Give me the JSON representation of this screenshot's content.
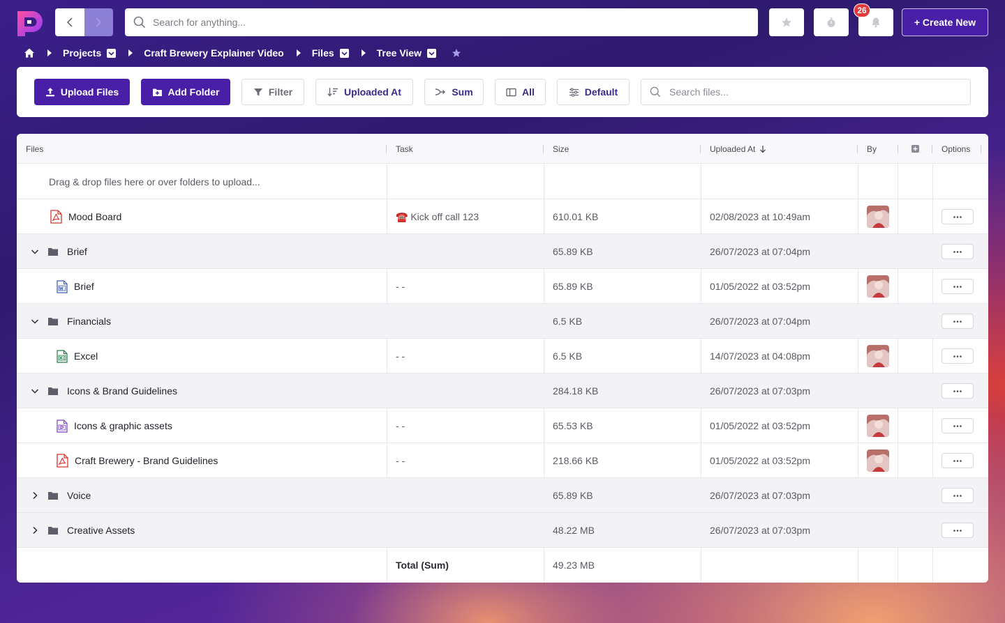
{
  "topbar": {
    "search_placeholder": "Search for anything...",
    "notification_count": "26",
    "create_label": "+ Create New"
  },
  "breadcrumb": {
    "items": [
      "Projects",
      "Craft Brewery Explainer Video",
      "Files",
      "Tree View"
    ]
  },
  "toolbar": {
    "upload_label": "Upload Files",
    "add_folder_label": "Add Folder",
    "filter_label": "Filter",
    "sort_label": "Uploaded At",
    "sum_label": "Sum",
    "columns_label": "All",
    "view_label": "Default",
    "search_placeholder": "Search files..."
  },
  "table": {
    "headers": {
      "files": "Files",
      "task": "Task",
      "size": "Size",
      "uploaded_at": "Uploaded At",
      "by": "By",
      "options": "Options"
    },
    "drop_hint": "Drag & drop files here or over folders to upload...",
    "rows": [
      {
        "name": "Mood Board",
        "icon": "pdf-file-icon",
        "task": "☎️ Kick off call 123",
        "size": "610.01 KB",
        "uploaded": "02/08/2023 at 10:49am"
      },
      {
        "name": "Brief",
        "icon": "folder-icon",
        "task": "",
        "size": "65.89 KB",
        "uploaded": "26/07/2023 at 07:04pm"
      },
      {
        "name": "Brief",
        "icon": "word-file-icon",
        "task": "- -",
        "size": "65.89 KB",
        "uploaded": "01/05/2022 at 03:52pm"
      },
      {
        "name": "Financials",
        "icon": "folder-icon",
        "task": "",
        "size": "6.5 KB",
        "uploaded": "26/07/2023 at 07:04pm"
      },
      {
        "name": "Excel",
        "icon": "excel-file-icon",
        "task": "- -",
        "size": "6.5 KB",
        "uploaded": "14/07/2023 at 04:08pm"
      },
      {
        "name": "Icons & Brand Guidelines",
        "icon": "folder-icon",
        "task": "",
        "size": "284.18 KB",
        "uploaded": "26/07/2023 at 07:03pm"
      },
      {
        "name": "Icons & graphic assets",
        "icon": "design-file-icon",
        "task": "- -",
        "size": "65.53 KB",
        "uploaded": "01/05/2022 at 03:52pm"
      },
      {
        "name": "Craft Brewery - Brand Guidelines",
        "icon": "pdf-file-icon",
        "task": "- -",
        "size": "218.66 KB",
        "uploaded": "01/05/2022 at 03:52pm"
      },
      {
        "name": "Voice",
        "icon": "folder-icon",
        "task": "",
        "size": "65.89 KB",
        "uploaded": "26/07/2023 at 07:03pm"
      },
      {
        "name": "Creative Assets",
        "icon": "folder-icon",
        "task": "",
        "size": "48.22 MB",
        "uploaded": "26/07/2023 at 07:03pm"
      }
    ],
    "total_label": "Total (Sum)",
    "total_value": "49.23 MB"
  },
  "colors": {
    "brand": "#4a1fa8",
    "badge": "#e23b3b",
    "pdf": "#d9342b",
    "excel": "#1f7a45",
    "word": "#3b5bb5",
    "design": "#7b3fc4"
  }
}
